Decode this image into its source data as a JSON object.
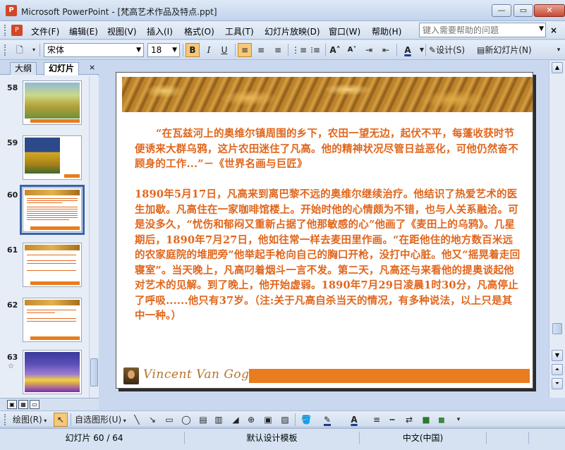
{
  "window": {
    "app_name": "Microsoft PowerPoint",
    "title": "Microsoft PowerPoint - [梵高艺术作品及特点.ppt]",
    "minimize": "—",
    "maximize": "▭",
    "close": "✕"
  },
  "menubar": {
    "items": [
      "文件(F)",
      "编辑(E)",
      "视图(V)",
      "插入(I)",
      "格式(O)",
      "工具(T)",
      "幻灯片放映(D)",
      "窗口(W)",
      "帮助(H)"
    ],
    "help_placeholder": "键入需要帮助的问题",
    "close": "×"
  },
  "format_toolbar": {
    "font_name": "宋体",
    "font_size": "18",
    "bold": "B",
    "italic": "I",
    "underline": "U",
    "design_label": "设计(S)",
    "new_slide_label": "新幻灯片(N)"
  },
  "left_panel": {
    "tabs": [
      "大纲",
      "幻灯片"
    ],
    "active_tab": "幻灯片",
    "close": "×",
    "thumbnails": [
      {
        "number": "58",
        "kind": "painting"
      },
      {
        "number": "59",
        "kind": "painting"
      },
      {
        "number": "60",
        "kind": "text",
        "selected": true
      },
      {
        "number": "61",
        "kind": "text"
      },
      {
        "number": "62",
        "kind": "text"
      },
      {
        "number": "63",
        "kind": "painting",
        "star": "☆"
      }
    ]
  },
  "slide": {
    "paragraph1": "“在瓦兹河上的奥维尔镇周围的乡下，农田一望无边，起伏不平，每蓬收获时节便诱来大群乌鸦，这片农田迷住了凡高。他的精神状况尽管日益恶化，可他仍然奋不顾身的工作...”－《世界名画与巨匠》",
    "paragraph2": "1890年5月17日，凡高来到离巴黎不远的奥维尔继续治疗。他结识了热爱艺术的医生加歇。凡高住在一家咖啡馆楼上。开始时他的心情颇为不错，也与人关系融洽。可是没多久，“忧伤和郁闷又重新占据了他那敏感的心”他画了《麦田上的乌鸦》。几星期后，1890年7月27日，他如往常一样去麦田里作画。“在距他住的地方数百米远的农家庭院的堆肥旁”他举起手枪向自己的胸口开枪，没打中心脏。他又“摇晃着走回寝室”。当天晚上，凡高叼着烟斗一言不发。第二天，凡高还与来看他的提奥谈起他对艺术的见解。到了晚上，他开始虚弱。1890年7月29日凌晨1时30分，凡高停止了呼吸......他只有37岁。（注:关于凡高自杀当天的情况，有多种说法，以上只是其中一种。）",
    "footer_name": "Vincent Van Gogh",
    "text_color": "#e0661d",
    "footer_bar_color": "#e87c1e"
  },
  "draw_toolbar": {
    "draw_label": "绘图(R)",
    "autoshapes_label": "自选图形(U)"
  },
  "statusbar": {
    "slide_position": "幻灯片 60 / 64",
    "template": "默认设计模板",
    "language": "中文(中国)"
  }
}
